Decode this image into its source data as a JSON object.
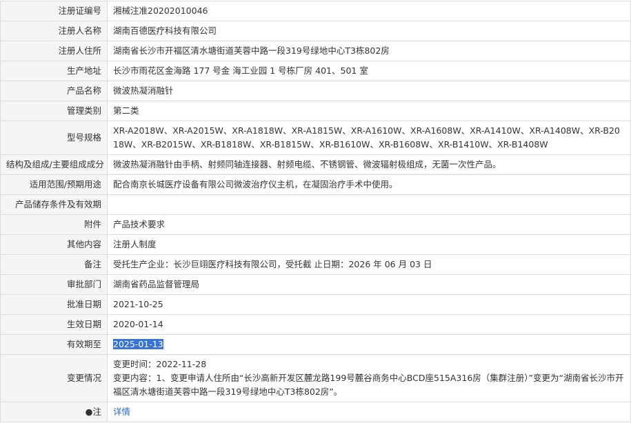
{
  "rows": [
    {
      "label": "注册证编号",
      "value": "湘械注准20202010046"
    },
    {
      "label": "注册人名称",
      "value": "湖南百德医疗科技有限公司"
    },
    {
      "label": "注册人住所",
      "value": "湖南省长沙市开福区清水塘街道芙蓉中路一段319号绿地中心T3栋802房"
    },
    {
      "label": "生产地址",
      "value": "长沙市雨花区金海路 177 号金 海工业园 1 号栋厂房 401、501 室"
    },
    {
      "label": "产品名称",
      "value": "微波热凝消融针"
    },
    {
      "label": "管理类别",
      "value": "第二类"
    },
    {
      "label": "型号规格",
      "value": "XR-A2018W、XR-A2015W、XR-A1818W、XR-A1815W、XR-A1610W、XR-A1608W、XR-A1410W、XR-A1408W、XR-B2018W、XR-B2015W、XR-B1818W、XR-B1815W、XR-B1610W、XR-B1608W、XR-B1410W、XR-B1408W"
    },
    {
      "label": "结构及组成/主要组成成分",
      "value": "微波热凝消融针由手柄、射频同轴连接器、射频电缆、不锈钢管、微波辐射极组成，无菌一次性产品。"
    },
    {
      "label": "适用范围/预期用途",
      "value": "配合南京长城医疗设备有限公司微波治疗仪主机，在凝固治疗手术中使用。"
    },
    {
      "label": "产品储存条件及有效期",
      "value": ""
    },
    {
      "label": "附件",
      "value": "产品技术要求"
    },
    {
      "label": "其他内容",
      "value": "注册人制度"
    },
    {
      "label": "备注",
      "value": "受托生产企业：长沙巨翊医疗科技有限公司，受托截 止日期：2026 年 06 月 03 日"
    },
    {
      "label": "审批部门",
      "value": "湖南省药品监督管理局"
    },
    {
      "label": "批准日期",
      "value": "2021-10-25"
    },
    {
      "label": "生效日期",
      "value": "2020-01-14"
    },
    {
      "label": "有效期至",
      "value": "2025-01-13"
    }
  ],
  "change": {
    "label": "变更情况",
    "time": "变更时间：2022-11-28",
    "content": "变更内容：1、变更申请人住所由“长沙高新开发区麓龙路199号麓谷商务中心BCD座515A316房（集群注册）”变更为“湖南省长沙市开福区清水塘街道芙蓉中路一段319号绿地中心T3栋802房”。"
  },
  "note": {
    "pin_icon": "●",
    "label": "注",
    "link": "详情"
  }
}
